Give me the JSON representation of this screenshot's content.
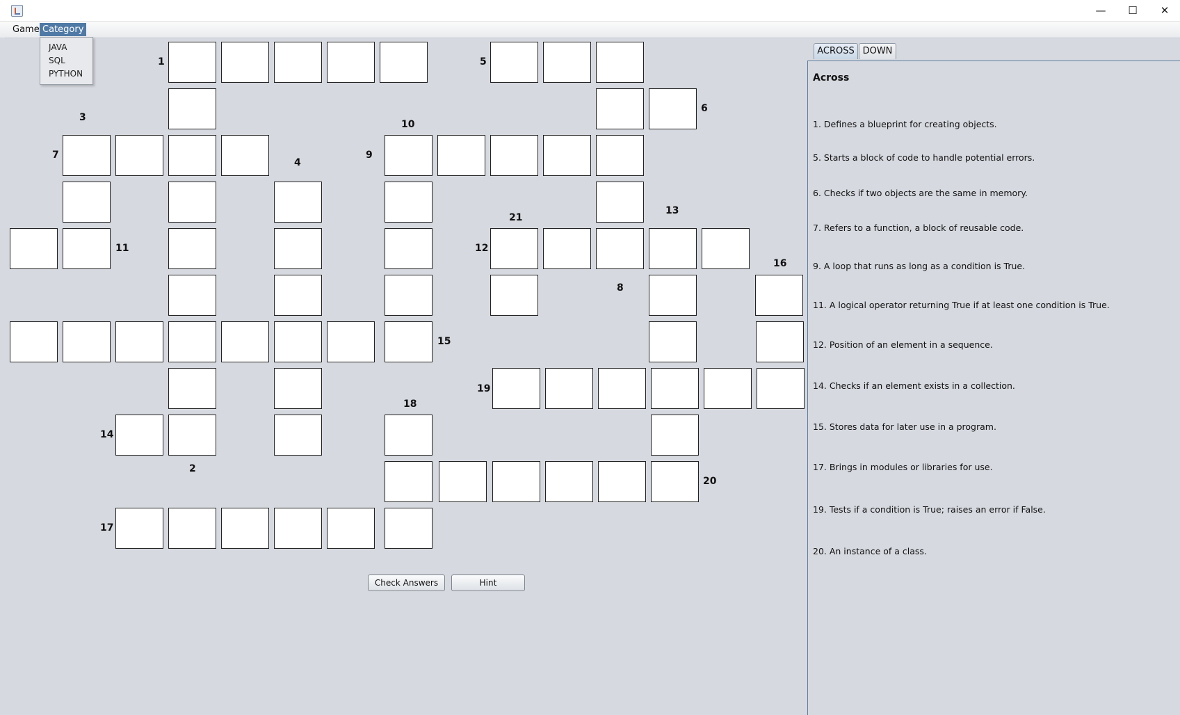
{
  "window": {
    "controls": {
      "minimize": "—",
      "maximize": "☐",
      "close": "✕"
    }
  },
  "menubar": {
    "game": "Game",
    "category": "Category"
  },
  "category_menu": [
    "JAVA",
    "SQL",
    "PYTHON"
  ],
  "grid": {
    "numbers": [
      "1",
      "5",
      "6",
      "3",
      "10",
      "7",
      "4",
      "9",
      "21",
      "13",
      "11",
      "12",
      "16",
      "8",
      "15",
      "19",
      "18",
      "14",
      "2",
      "20",
      "17"
    ]
  },
  "buttons": {
    "check": "Check Answers",
    "hint": "Hint"
  },
  "tabs": {
    "across": "ACROSS",
    "down": "DOWN"
  },
  "clues": {
    "heading": "Across",
    "across": [
      "1. Defines a blueprint for creating objects.",
      "5. Starts a block of code to handle potential errors.",
      "6. Checks if two objects are the same in memory.",
      "7. Refers to a function, a block of reusable code.",
      "9. A loop that runs as long as a condition is True.",
      "11. A logical operator returning True if at least one condition is True.",
      "12. Position of an element in a sequence.",
      "14. Checks if an element exists in a collection.",
      "15.  Stores data for later use in a program.",
      "17. Brings in modules or libraries for use.",
      "19.  Tests if a condition is True; raises an error if False.",
      "20. An instance of a class."
    ]
  },
  "colors": {
    "background": "#d6d9df",
    "menu_highlight": "#4f7aa6",
    "cell": "#ffffff"
  }
}
